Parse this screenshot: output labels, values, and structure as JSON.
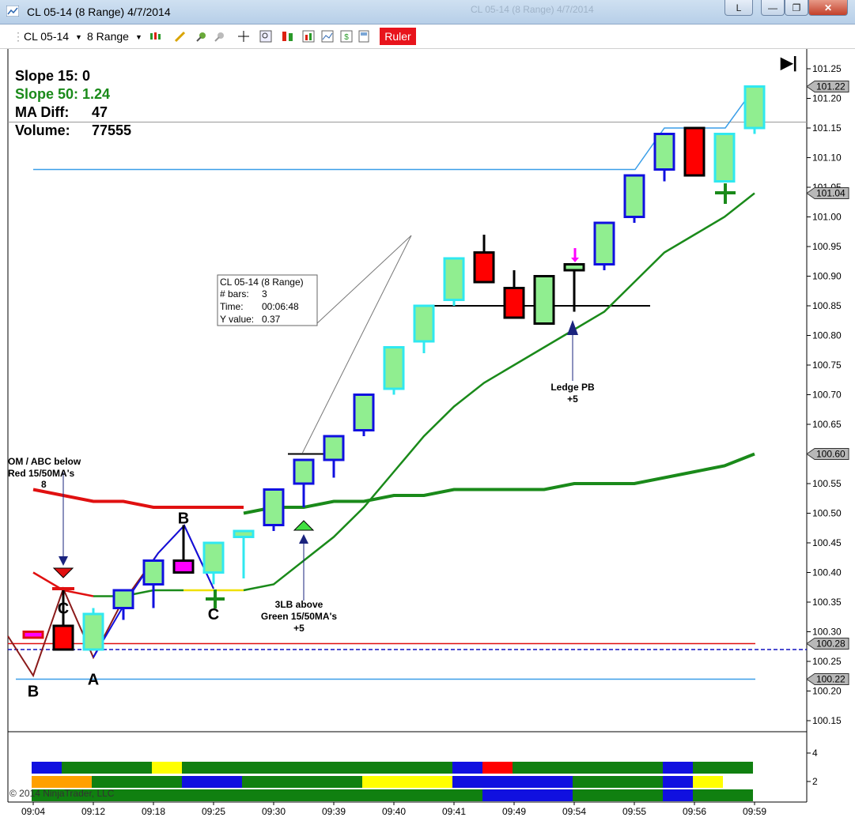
{
  "window": {
    "title": "CL 05-14 (8 Range)  4/7/2014",
    "ghost_title": "CL 05-14 (8 Range) 4/7/2014",
    "controls": {
      "l_label": "L",
      "minimize": "—",
      "maximize": "❐",
      "close": "✕"
    }
  },
  "toolbar": {
    "instrument": "CL 05-14",
    "interval": "8 Range",
    "ruler_label": "Ruler"
  },
  "stats": {
    "slope15": "Slope 15: 0",
    "slope50": "Slope 50: 1.24",
    "ma_diff_label": "MA Diff:",
    "ma_diff_value": "47",
    "volume_label": "Volume:",
    "volume_value": "77555"
  },
  "tooltip": {
    "line1": "CL 05-14 (8 Range)",
    "bars_label": "# bars:",
    "bars_value": "3",
    "time_label": "Time:",
    "time_value": "00:06:48",
    "y_label": "Y value:",
    "y_value": "0.37"
  },
  "annotations": {
    "left_line1": "OM / ABC below",
    "left_line2": "Red 15/50MA's",
    "left_line3": "8",
    "mid_line1": "3LB above",
    "mid_line2": "Green 15/50MA's",
    "mid_line3": "+5",
    "ledge_line1": "Ledge PB",
    "ledge_line2": "+5",
    "pivots": [
      {
        "t": "B",
        "i": 0,
        "p": 100.22
      },
      {
        "t": "C",
        "i": 1,
        "p": 100.36
      },
      {
        "t": "A",
        "i": 2,
        "p": 100.24
      },
      {
        "t": "B",
        "i": 5,
        "p": 100.48
      },
      {
        "t": "C",
        "i": 6,
        "p": 100.35
      }
    ]
  },
  "copyright": "© 2014 NinjaTrader, LLC",
  "colors": {
    "up_fill": "#90ee90",
    "down_fill": "#ff0000",
    "blue_outline": "#1010e0",
    "cyan_outline": "#30e8f0",
    "black_outline": "#000000",
    "magenta": "#ff00ff",
    "green_ma": "#1a8a1a",
    "red_ma": "#e01010",
    "light_blue": "#3a9ee8"
  },
  "chart_data": {
    "type": "candlestick",
    "instrument": "CL 05-14 (8 Range)",
    "ylim": [
      100.12,
      101.3
    ],
    "y_ticks": [
      101.25,
      101.2,
      101.15,
      101.1,
      101.05,
      101.0,
      100.95,
      100.9,
      100.85,
      100.8,
      100.75,
      100.7,
      100.65,
      100.6,
      100.55,
      100.5,
      100.45,
      100.4,
      100.35,
      100.3,
      100.25,
      100.2,
      100.15
    ],
    "x_labels": [
      "09:04",
      "09:12",
      "09:18",
      "09:25",
      "09:30",
      "09:39",
      "09:40",
      "09:41",
      "09:49",
      "09:54",
      "09:55",
      "09:56",
      "09:59"
    ],
    "price_markers": [
      {
        "label": "101.22",
        "value": 101.22
      },
      {
        "label": "101.04",
        "value": 101.04
      },
      {
        "label": "100.60",
        "value": 100.6
      },
      {
        "label": "100.28",
        "value": 100.28
      },
      {
        "label": "100.22",
        "value": 100.22
      }
    ],
    "bars": [
      {
        "o": 100.29,
        "h": 100.3,
        "l": 100.29,
        "c": 100.3,
        "fill": "magenta",
        "outline": "red"
      },
      {
        "o": 100.31,
        "h": 100.37,
        "l": 100.27,
        "c": 100.27,
        "fill": "red",
        "outline": "black"
      },
      {
        "o": 100.27,
        "h": 100.34,
        "l": 100.27,
        "c": 100.33,
        "fill": "green",
        "outline": "cyan"
      },
      {
        "o": 100.34,
        "h": 100.37,
        "l": 100.32,
        "c": 100.37,
        "fill": "green",
        "outline": "blue"
      },
      {
        "o": 100.38,
        "h": 100.42,
        "l": 100.34,
        "c": 100.42,
        "fill": "green",
        "outline": "blue"
      },
      {
        "o": 100.42,
        "h": 100.48,
        "l": 100.4,
        "c": 100.4,
        "fill": "magenta",
        "outline": "black"
      },
      {
        "o": 100.4,
        "h": 100.45,
        "l": 100.38,
        "c": 100.45,
        "fill": "green",
        "outline": "cyan"
      },
      {
        "o": 100.46,
        "h": 100.47,
        "l": 100.39,
        "c": 100.47,
        "fill": "green",
        "outline": "cyan"
      },
      {
        "o": 100.48,
        "h": 100.54,
        "l": 100.47,
        "c": 100.54,
        "fill": "green",
        "outline": "blue"
      },
      {
        "o": 100.55,
        "h": 100.59,
        "l": 100.51,
        "c": 100.59,
        "fill": "green",
        "outline": "blue"
      },
      {
        "o": 100.59,
        "h": 100.63,
        "l": 100.56,
        "c": 100.63,
        "fill": "green",
        "outline": "blue"
      },
      {
        "o": 100.64,
        "h": 100.7,
        "l": 100.63,
        "c": 100.7,
        "fill": "green",
        "outline": "blue"
      },
      {
        "o": 100.71,
        "h": 100.78,
        "l": 100.7,
        "c": 100.78,
        "fill": "green",
        "outline": "cyan"
      },
      {
        "o": 100.79,
        "h": 100.85,
        "l": 100.77,
        "c": 100.85,
        "fill": "green",
        "outline": "cyan"
      },
      {
        "o": 100.86,
        "h": 100.93,
        "l": 100.85,
        "c": 100.93,
        "fill": "green",
        "outline": "cyan"
      },
      {
        "o": 100.94,
        "h": 100.97,
        "l": 100.89,
        "c": 100.89,
        "fill": "red",
        "outline": "black"
      },
      {
        "o": 100.88,
        "h": 100.91,
        "l": 100.83,
        "c": 100.83,
        "fill": "red",
        "outline": "black"
      },
      {
        "o": 100.82,
        "h": 100.9,
        "l": 100.82,
        "c": 100.9,
        "fill": "green",
        "outline": "black"
      },
      {
        "o": 100.91,
        "h": 100.92,
        "l": 100.84,
        "c": 100.92,
        "fill": "green",
        "outline": "black"
      },
      {
        "o": 100.92,
        "h": 100.99,
        "l": 100.91,
        "c": 100.99,
        "fill": "green",
        "outline": "blue"
      },
      {
        "o": 101.0,
        "h": 101.07,
        "l": 100.99,
        "c": 101.07,
        "fill": "green",
        "outline": "blue"
      },
      {
        "o": 101.08,
        "h": 101.14,
        "l": 101.06,
        "c": 101.14,
        "fill": "green",
        "outline": "blue"
      },
      {
        "o": 101.15,
        "h": 101.15,
        "l": 101.07,
        "c": 101.07,
        "fill": "red",
        "outline": "black"
      },
      {
        "o": 101.06,
        "h": 101.14,
        "l": 101.06,
        "c": 101.14,
        "fill": "green",
        "outline": "cyan"
      },
      {
        "o": 101.15,
        "h": 101.22,
        "l": 101.14,
        "c": 101.22,
        "fill": "green",
        "outline": "cyan"
      }
    ],
    "ma_fast": [
      100.4,
      100.37,
      100.36,
      100.36,
      100.37,
      100.37,
      100.37,
      100.37,
      100.38,
      100.42,
      100.46,
      100.51,
      100.57,
      100.63,
      100.68,
      100.72,
      100.75,
      100.78,
      100.81,
      100.84,
      100.89,
      100.94,
      100.97,
      101.0,
      101.04
    ],
    "ma_slow": [
      null,
      null,
      null,
      null,
      null,
      null,
      null,
      100.5,
      100.51,
      100.51,
      100.52,
      100.52,
      100.53,
      100.53,
      100.54,
      100.54,
      100.54,
      100.54,
      100.55,
      100.55,
      100.55,
      100.56,
      100.57,
      100.58,
      100.6
    ],
    "ma_slow_red": [
      100.54,
      100.53,
      100.52,
      100.52,
      100.51,
      100.51,
      100.51,
      100.51
    ],
    "level_lines": {
      "red": 100.28,
      "blue_dashed": 100.27,
      "light_blue_low": 100.22,
      "light_blue_upper": 101.08,
      "gray": 101.16
    },
    "ledge_line": 100.85,
    "indicator_rows": [
      [
        [
          "blue",
          1
        ],
        [
          "green",
          3
        ],
        [
          "yellow",
          1
        ],
        [
          "green",
          9
        ],
        [
          "blue",
          1
        ],
        [
          "red",
          1
        ],
        [
          "green",
          5
        ],
        [
          "blue",
          1
        ],
        [
          "green",
          2
        ]
      ],
      [
        [
          "orange",
          2
        ],
        [
          "green",
          3
        ],
        [
          "blue",
          2
        ],
        [
          "green",
          4
        ],
        [
          "yellow",
          3
        ],
        [
          "blue",
          4
        ],
        [
          "green",
          3
        ],
        [
          "blue",
          1
        ],
        [
          "yellow",
          1
        ]
      ],
      [
        [
          "green",
          15
        ],
        [
          "blue",
          3
        ],
        [
          "green",
          3
        ],
        [
          "blue",
          1
        ],
        [
          "green",
          2
        ]
      ]
    ],
    "indicator_ticks": [
      "4",
      "2"
    ]
  }
}
